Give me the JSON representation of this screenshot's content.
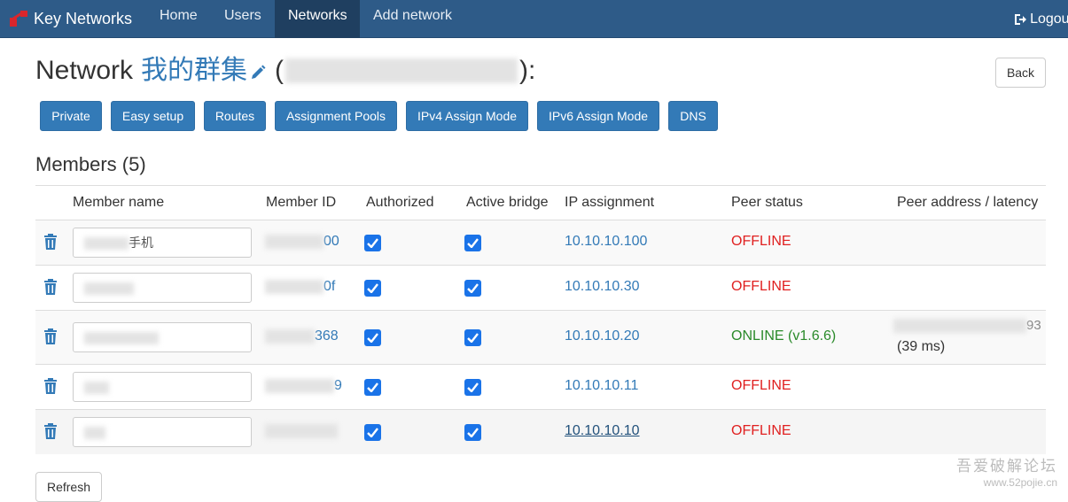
{
  "navbar": {
    "brand": "Key Networks",
    "links": [
      "Home",
      "Users",
      "Networks",
      "Add network"
    ],
    "active": "Networks",
    "logout": "Logout"
  },
  "page": {
    "title_prefix": "Network",
    "network_name": "我的群集",
    "paren_open": "(",
    "paren_close": "):",
    "back": "Back"
  },
  "actions": [
    "Private",
    "Easy setup",
    "Routes",
    "Assignment Pools",
    "IPv4 Assign Mode",
    "IPv6 Assign Mode",
    "DNS"
  ],
  "members": {
    "title": "Members (5)",
    "headers": [
      "Member name",
      "Member ID",
      "Authorized",
      "Active bridge",
      "IP assignment",
      "Peer status",
      "Peer address / latency"
    ],
    "rows": [
      {
        "name": "手机",
        "id_tail": "00",
        "authorized": true,
        "bridge": true,
        "ip": "10.10.10.100",
        "status": "OFFLINE",
        "peer": ""
      },
      {
        "name": "",
        "id_tail": "0f",
        "authorized": true,
        "bridge": true,
        "ip": "10.10.10.30",
        "status": "OFFLINE",
        "peer": ""
      },
      {
        "name": "",
        "id_tail": "368",
        "authorized": true,
        "bridge": true,
        "ip": "10.10.10.20",
        "status": "ONLINE (v1.6.6)",
        "peer_tail": "93",
        "latency": "(39 ms)"
      },
      {
        "name": "",
        "id_tail": "9",
        "authorized": true,
        "bridge": true,
        "ip": "10.10.10.11",
        "status": "OFFLINE",
        "peer": ""
      },
      {
        "name": "",
        "id_tail": "",
        "authorized": true,
        "bridge": true,
        "ip": "10.10.10.10",
        "status": "OFFLINE",
        "peer": ""
      }
    ]
  },
  "refresh": "Refresh",
  "watermark": {
    "line1": "吾爱破解论坛",
    "line2": "www.52pojie.cn"
  },
  "colors": {
    "navbar": "#2e5b88",
    "primary": "#337ab7",
    "offline": "#e02020",
    "online": "#2a8a2a",
    "checkbox": "#1a73e8"
  }
}
